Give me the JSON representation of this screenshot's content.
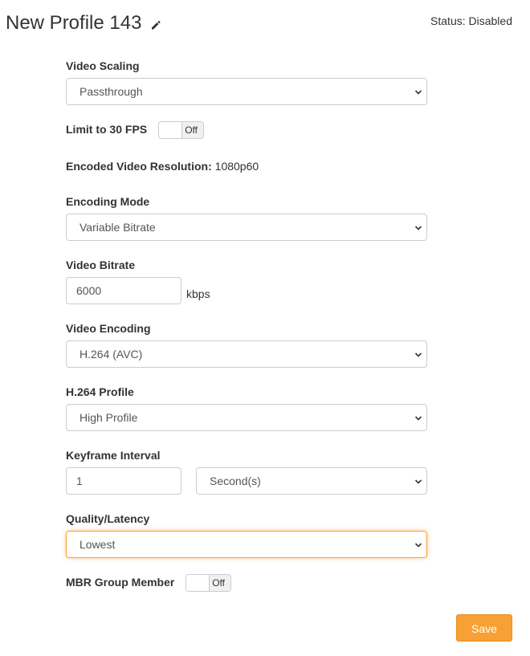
{
  "header": {
    "title": "New Profile 143",
    "edit_icon": "pencil-icon",
    "status": "Status: Disabled"
  },
  "fields": {
    "video_scaling": {
      "label": "Video Scaling",
      "value": "Passthrough"
    },
    "limit_30fps": {
      "label": "Limit to 30 FPS",
      "state": "Off"
    },
    "encoded_resolution": {
      "label": "Encoded Video Resolution:",
      "value": "1080p60"
    },
    "encoding_mode": {
      "label": "Encoding Mode",
      "value": "Variable Bitrate"
    },
    "video_bitrate": {
      "label": "Video Bitrate",
      "value": "6000",
      "unit": "kbps"
    },
    "video_encoding": {
      "label": "Video Encoding",
      "value": "H.264 (AVC)"
    },
    "h264_profile": {
      "label": "H.264 Profile",
      "value": "High Profile"
    },
    "keyframe_interval": {
      "label": "Keyframe Interval",
      "value": "1",
      "unit_value": "Second(s)"
    },
    "quality_latency": {
      "label": "Quality/Latency",
      "value": "Lowest"
    },
    "mbr_group_member": {
      "label": "MBR Group Member",
      "state": "Off"
    }
  },
  "actions": {
    "save_label": "Save"
  },
  "colors": {
    "accent": "#f7a035",
    "focus_border": "#f7a035",
    "text": "#333333"
  }
}
